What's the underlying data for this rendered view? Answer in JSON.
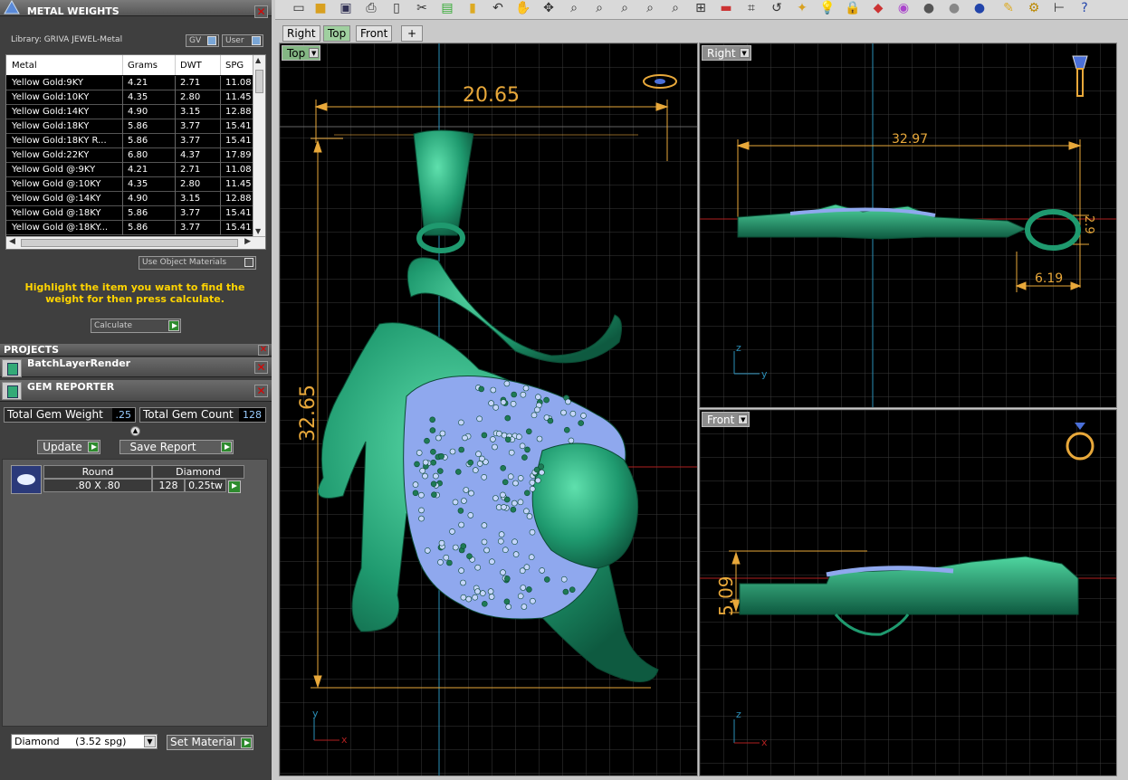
{
  "metal_panel": {
    "title": "METAL WEIGHTS",
    "library": "Library: GRIVA JEWEL-Metal",
    "gv_label": "GV",
    "user_label": "User",
    "columns": [
      "Metal",
      "Grams",
      "DWT",
      "SPG"
    ],
    "rows": [
      {
        "metal": "Yellow Gold:9KY",
        "grams": "4.21",
        "dwt": "2.71",
        "spg": "11.08"
      },
      {
        "metal": "Yellow Gold:10KY",
        "grams": "4.35",
        "dwt": "2.80",
        "spg": "11.45"
      },
      {
        "metal": "Yellow Gold:14KY",
        "grams": "4.90",
        "dwt": "3.15",
        "spg": "12.88"
      },
      {
        "metal": "Yellow Gold:18KY",
        "grams": "5.86",
        "dwt": "3.77",
        "spg": "15.41"
      },
      {
        "metal": "Yellow Gold:18KY R...",
        "grams": "5.86",
        "dwt": "3.77",
        "spg": "15.41"
      },
      {
        "metal": "Yellow Gold:22KY",
        "grams": "6.80",
        "dwt": "4.37",
        "spg": "17.89"
      },
      {
        "metal": "Yellow Gold @:9KY",
        "grams": "4.21",
        "dwt": "2.71",
        "spg": "11.08"
      },
      {
        "metal": "Yellow Gold @:10KY",
        "grams": "4.35",
        "dwt": "2.80",
        "spg": "11.45"
      },
      {
        "metal": "Yellow Gold @:14KY",
        "grams": "4.90",
        "dwt": "3.15",
        "spg": "12.88"
      },
      {
        "metal": "Yellow Gold @:18KY",
        "grams": "5.86",
        "dwt": "3.77",
        "spg": "15.41"
      },
      {
        "metal": "Yellow Gold @:18KY...",
        "grams": "5.86",
        "dwt": "3.77",
        "spg": "15.41"
      }
    ],
    "use_object_materials": "Use Object Materials",
    "message": "Highlight the item you want to find the weight for then press calculate.",
    "calculate_label": "Calculate"
  },
  "projects": {
    "title": "PROJECTS",
    "batch_title": "BatchLayerRender",
    "gem_title": "GEM REPORTER"
  },
  "gem_reporter": {
    "total_weight_label": "Total Gem Weight",
    "total_weight_value": ".25",
    "total_count_label": "Total Gem Count",
    "total_count_value": "128",
    "update_label": "Update",
    "save_label": "Save Report",
    "gem": {
      "shape": "Round",
      "type": "Diamond",
      "size": ".80 X .80",
      "count": "128",
      "weight": "0.25tw"
    },
    "material_select": "Diamond     (3.52 spg)",
    "set_material_label": "Set Material"
  },
  "tabs": [
    "Right",
    "Top",
    "Front",
    "+"
  ],
  "active_tab": "Top",
  "viewports": {
    "top": {
      "label": "Top",
      "dim_width": "20.65",
      "dim_height": "32.65",
      "axis_y": "y",
      "axis_x": "x"
    },
    "right": {
      "label": "Right",
      "dim_width": "32.97",
      "dim_small": "2.9",
      "dim_offset": "6.19",
      "axis_y": "z",
      "axis_x": "y"
    },
    "front": {
      "label": "Front",
      "dim_height": "5.09",
      "axis_y": "z",
      "axis_x": "x"
    }
  },
  "colors": {
    "model": "#1f9a6f",
    "model_light": "#43c995",
    "dimension": "#e8a83a",
    "grid": "#3a3a3a",
    "gems": "#9fb8ff"
  }
}
